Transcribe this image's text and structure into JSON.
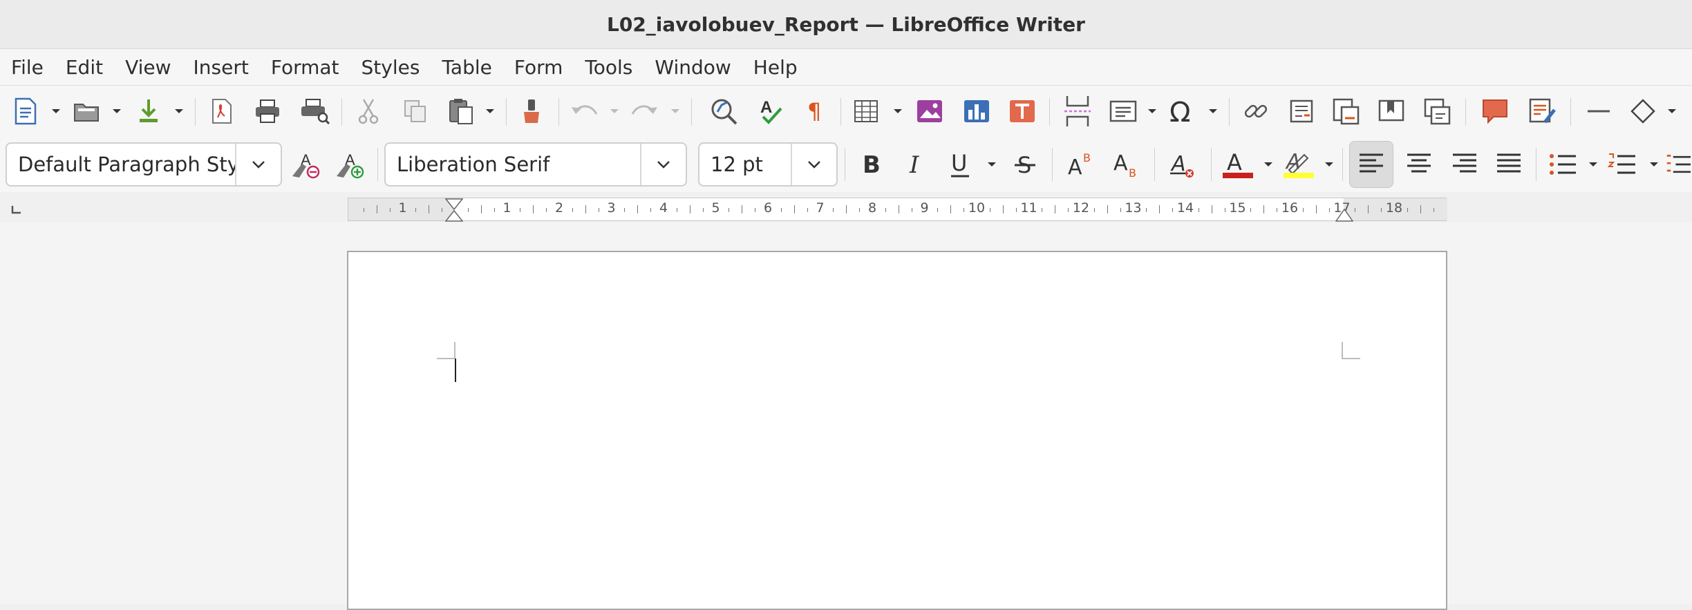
{
  "window": {
    "title": "L02_iavolobuev_Report — LibreOffice Writer"
  },
  "menubar": {
    "items": [
      "File",
      "Edit",
      "View",
      "Insert",
      "Format",
      "Styles",
      "Table",
      "Form",
      "Tools",
      "Window",
      "Help"
    ]
  },
  "toolbar": {
    "standard_icons": [
      "new-document-icon",
      "open-icon",
      "save-icon",
      "export-pdf-icon",
      "print-icon",
      "print-preview-icon",
      "cut-icon",
      "copy-icon",
      "paste-icon",
      "clone-formatting-icon",
      "undo-icon",
      "redo-icon",
      "find-replace-icon",
      "spelling-icon",
      "formatting-marks-icon",
      "insert-table-icon",
      "insert-image-icon",
      "insert-chart-icon",
      "insert-textbox-icon",
      "page-break-icon",
      "insert-field-icon",
      "special-character-icon",
      "hyperlink-icon",
      "footnote-icon",
      "endnote-icon",
      "bookmark-icon",
      "cross-reference-icon",
      "comment-icon",
      "track-changes-icon",
      "horizontal-line-icon",
      "basic-shapes-icon"
    ],
    "paragraph_style": "Default Paragraph Sty",
    "font_name": "Liberation Serif",
    "font_size": "12 pt",
    "colors": {
      "font_color": "#c9211e",
      "highlight_color": "#ffff38",
      "accent": "#3b6fb6"
    }
  },
  "ruler": {
    "labels": [
      "1",
      "1",
      "2",
      "3",
      "4",
      "5",
      "6",
      "7",
      "8",
      "9",
      "10",
      "11",
      "12",
      "13",
      "14",
      "15",
      "16",
      "17",
      "18"
    ]
  },
  "document": {
    "text": ""
  }
}
